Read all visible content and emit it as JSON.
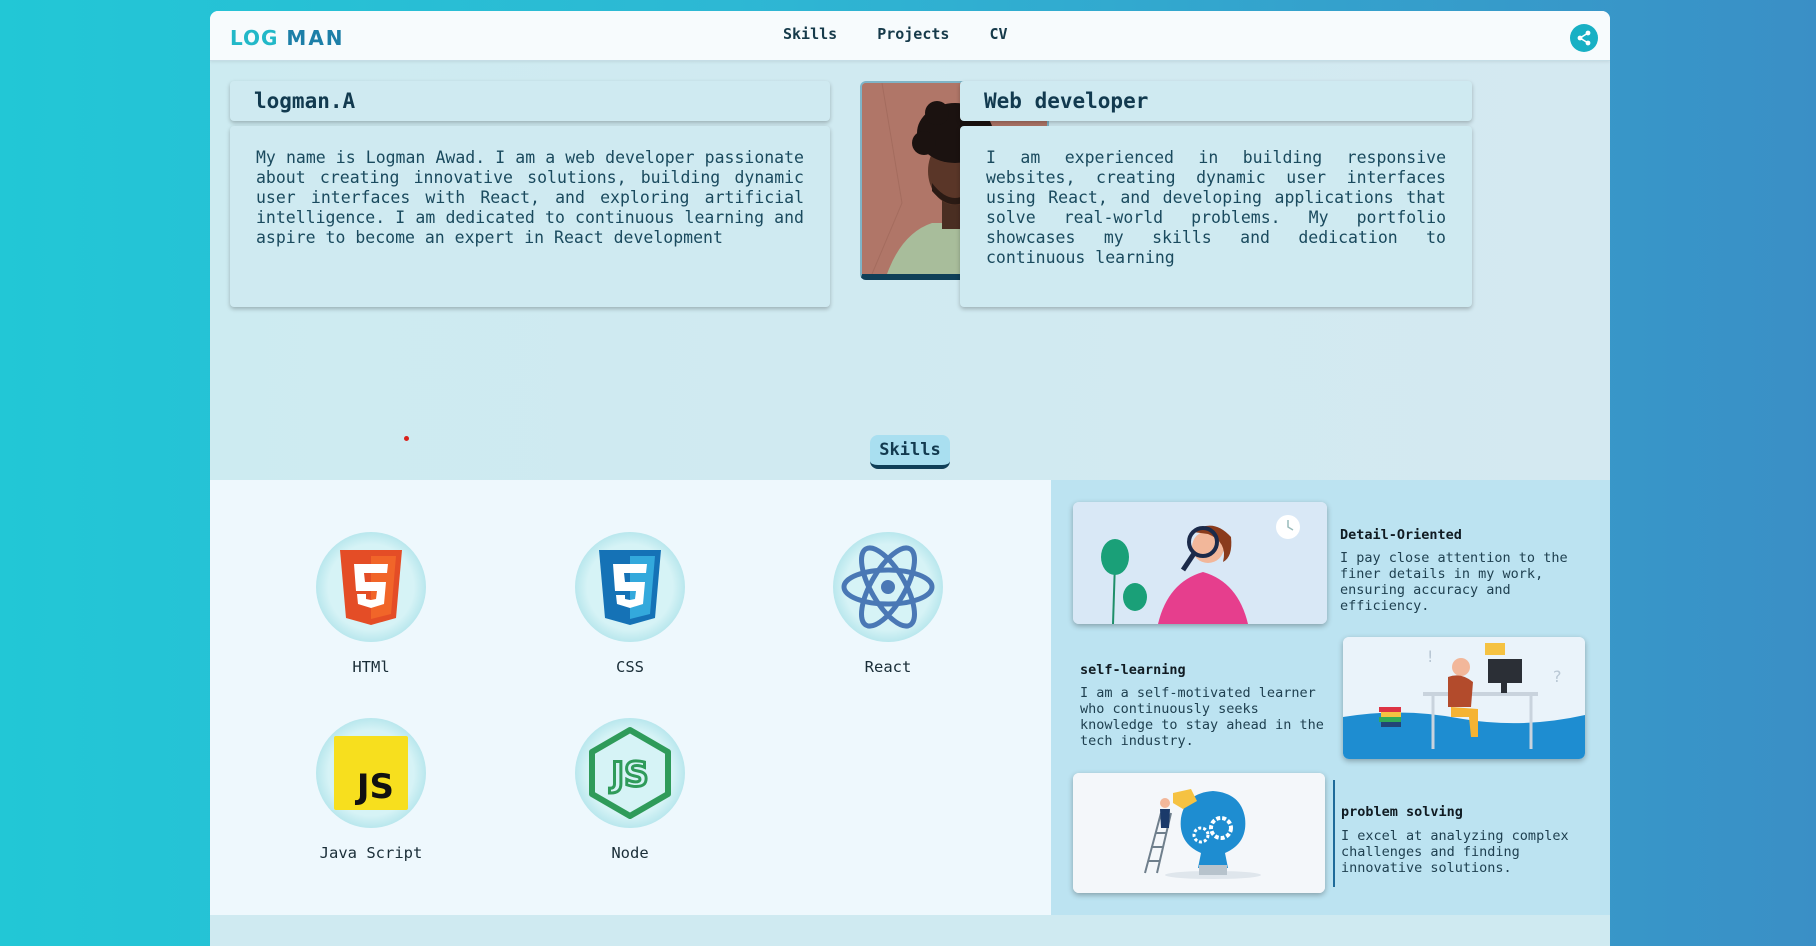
{
  "nav": {
    "logo_part1": "LOG",
    "logo_part2": "MAN",
    "links": [
      "Skills",
      "Projects",
      "CV"
    ]
  },
  "intro": {
    "name": "logman.A",
    "bio": "My name is Logman Awad. I am a web developer passionate about creating innovative solutions, building dynamic user interfaces with React, and exploring artificial intelligence. I am dedicated to continuous learning and aspire to become an expert in React development",
    "role": "Web developer",
    "role_desc": "I am experienced in building responsive websites, creating dynamic user interfaces using React, and developing applications that solve real-world problems. My portfolio showcases my skills and dedication to continuous learning"
  },
  "skills": {
    "title": "Skills",
    "items": [
      {
        "label": "HTMl",
        "icon": "html5-icon"
      },
      {
        "label": "CSS",
        "icon": "css3-icon"
      },
      {
        "label": "React",
        "icon": "react-icon"
      },
      {
        "label": "Java Script",
        "icon": "javascript-icon"
      },
      {
        "label": "Node",
        "icon": "nodejs-icon"
      }
    ]
  },
  "traits": [
    {
      "title": "Detail-Oriented",
      "desc": "I pay close attention to the finer details in my work, ensuring accuracy and efficiency."
    },
    {
      "title": "self-learning",
      "desc": "I am a self-motivated learner who continuously seeks knowledge to stay ahead in the tech industry."
    },
    {
      "title": "problem solving",
      "desc": "I excel at analyzing complex challenges and finding innovative solutions."
    }
  ],
  "colors": {
    "accent": "#22b8c8",
    "dark": "#0f3f58",
    "background_gradient_start": "#22c7d6",
    "background_gradient_end": "#3a8fc6"
  }
}
